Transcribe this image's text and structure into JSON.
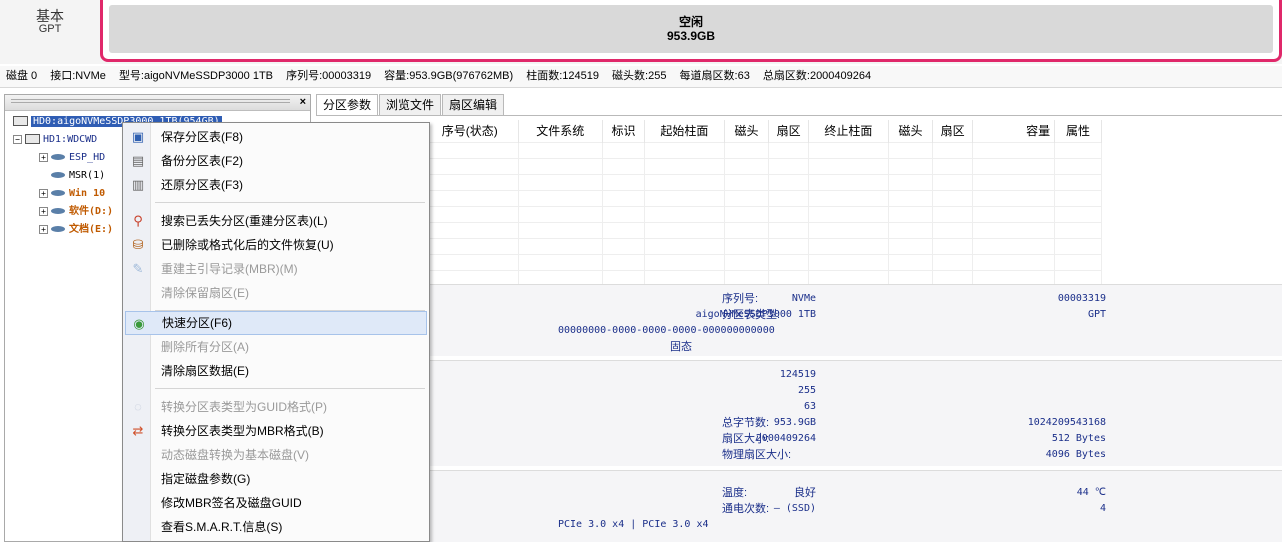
{
  "disk_map": {
    "type_line1": "基本",
    "type_line2": "GPT",
    "partition_label": "空闲",
    "partition_size": "953.9GB"
  },
  "disk_info": {
    "disk": "磁盘 0",
    "interface": "接口:NVMe",
    "model": "型号:aigoNVMeSSDP3000 1TB",
    "serial": "序列号:00003319",
    "capacity": "容量:953.9GB(976762MB)",
    "cylinders": "柱面数:124519",
    "heads": "磁头数:255",
    "sectors_per_track": "每道扇区数:63",
    "total_sectors": "总扇区数:2000409264"
  },
  "tree": {
    "items": [
      {
        "label": "HD0:aigoNVMeSSDP3000 1TB(954GB)"
      },
      {
        "label": "HD1:WDCWD"
      },
      {
        "label": "ESP_HD"
      },
      {
        "label": "MSR(1)"
      },
      {
        "label": "Win 10"
      },
      {
        "label": "软件(D:)"
      },
      {
        "label": "文档(E:)"
      }
    ]
  },
  "tabs": [
    "分区参数",
    "浏览文件",
    "扇区编辑"
  ],
  "partition_table": {
    "headers": [
      "序号(状态)",
      "文件系统",
      "标识",
      "起始柱面",
      "磁头",
      "扇区",
      "终止柱面",
      "磁头",
      "扇区",
      "容量",
      "属性"
    ]
  },
  "info_panel": {
    "interface": "NVMe",
    "model": "aigoNVMeSSDP3000 1TB",
    "guid": "00000000-0000-0000-0000-000000000000",
    "state": "固态",
    "serial_label": "序列号:",
    "serial": "00003319",
    "pt_type_label": "分区表类型:",
    "pt_type": "GPT",
    "cylinders": "124519",
    "heads": "255",
    "spt": "63",
    "capacity": "953.9GB",
    "total_sectors": "2000409264",
    "total_bytes_label": "总字节数:",
    "total_bytes": "1024209543168",
    "sector_size_label": "扇区大小:",
    "sector_size": "512 Bytes",
    "phys_sector_label": "物理扇区大小:",
    "phys_sector": "4096 Bytes",
    "health": "良好",
    "temp_label": "温度:",
    "temp": "44 ℃",
    "ssd": "— (SSD)",
    "power_label": "通电次数:",
    "power": "4",
    "pcie": "PCIe 3.0 x4 | PCIe 3.0 x4"
  },
  "context_menu": {
    "items": [
      {
        "label": "保存分区表(F8)",
        "disabled": false
      },
      {
        "label": "备份分区表(F2)",
        "disabled": false
      },
      {
        "label": "还原分区表(F3)",
        "disabled": false
      },
      {
        "label": "搜索已丢失分区(重建分区表)(L)",
        "disabled": false
      },
      {
        "label": "已删除或格式化后的文件恢复(U)",
        "disabled": false
      },
      {
        "label": "重建主引导记录(MBR)(M)",
        "disabled": true
      },
      {
        "label": "清除保留扇区(E)",
        "disabled": true
      },
      {
        "label": "快速分区(F6)",
        "disabled": false
      },
      {
        "label": "删除所有分区(A)",
        "disabled": true
      },
      {
        "label": "清除扇区数据(E)",
        "disabled": false
      },
      {
        "label": "转换分区表类型为GUID格式(P)",
        "disabled": true
      },
      {
        "label": "转换分区表类型为MBR格式(B)",
        "disabled": false
      },
      {
        "label": "动态磁盘转换为基本磁盘(V)",
        "disabled": true
      },
      {
        "label": "指定磁盘参数(G)",
        "disabled": false
      },
      {
        "label": "修改MBR签名及磁盘GUID",
        "disabled": false
      },
      {
        "label": "查看S.M.A.R.T.信息(S)",
        "disabled": false
      }
    ]
  }
}
